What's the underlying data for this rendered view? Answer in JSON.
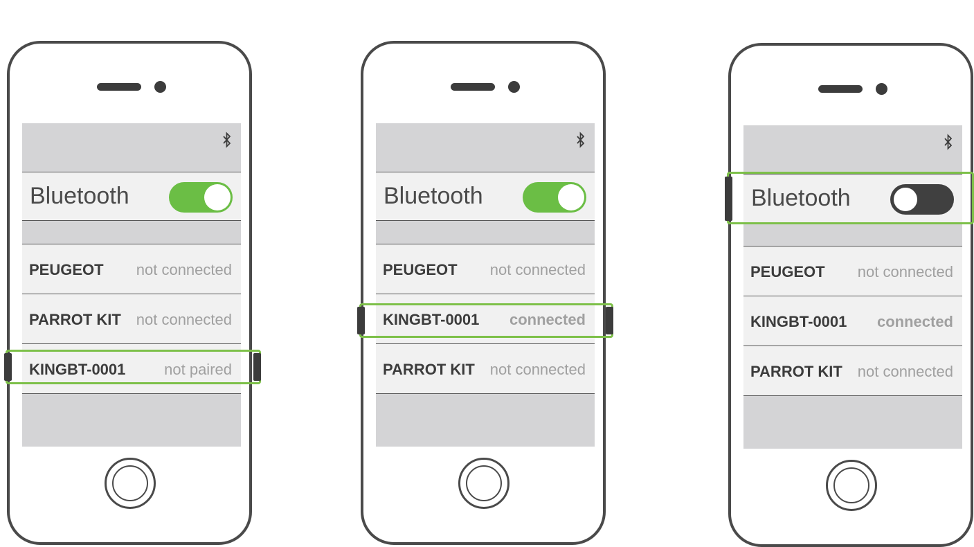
{
  "phones": [
    {
      "bluetooth_label": "Bluetooth",
      "bluetooth_state": "on",
      "devices": [
        {
          "name": "PEUGEOT",
          "status": "not connected"
        },
        {
          "name": "PARROT KIT",
          "status": "not connected"
        },
        {
          "name": "KINGBT-0001",
          "status": "not paired"
        }
      ],
      "highlighted": "device-3"
    },
    {
      "bluetooth_label": "Bluetooth",
      "bluetooth_state": "on",
      "devices": [
        {
          "name": "PEUGEOT",
          "status": "not connected"
        },
        {
          "name": "KINGBT-0001",
          "status": "connected"
        },
        {
          "name": "PARROT KIT",
          "status": "not connected"
        }
      ],
      "highlighted": "device-2"
    },
    {
      "bluetooth_label": "Bluetooth",
      "bluetooth_state": "off",
      "devices": [
        {
          "name": "PEUGEOT",
          "status": "not connected"
        },
        {
          "name": "KINGBT-0001",
          "status": "connected"
        },
        {
          "name": "PARROT KIT",
          "status": "not connected"
        }
      ],
      "highlighted": "bluetooth-row"
    }
  ],
  "colors": {
    "accent_green": "#6bbe45",
    "highlight_green": "#7dc049",
    "outline": "#4a4a4a",
    "screen_gray": "#d4d4d6",
    "row_bg": "#f1f1f1",
    "status_gray": "#a0a0a0"
  },
  "icons": {
    "status_bar": "bluetooth-icon",
    "home": "home-button-icon"
  }
}
